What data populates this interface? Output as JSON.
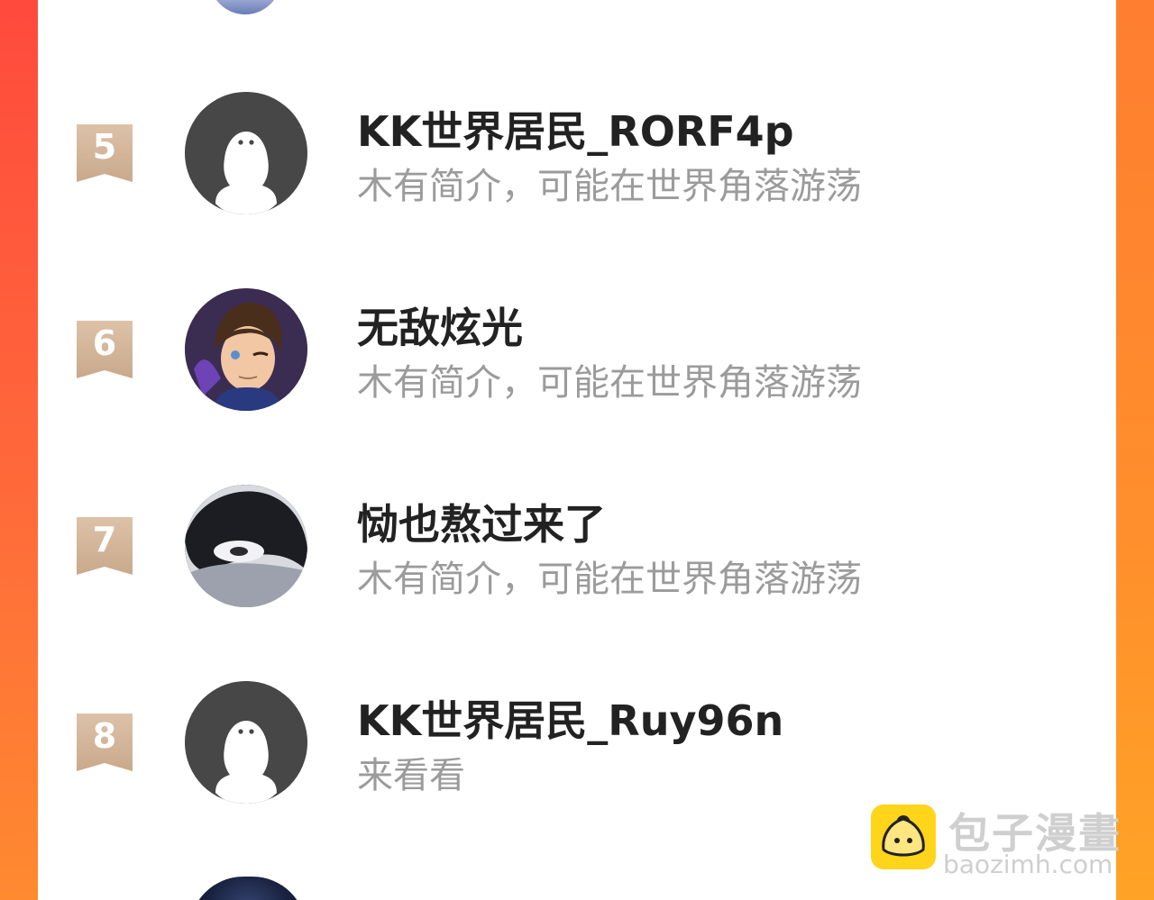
{
  "ranking": {
    "rows": [
      {
        "rank": "5",
        "name": "KK世界居民_RORF4p",
        "bio": "木有简介，可能在世界角落游荡",
        "avatar": "default-ghost-avatar"
      },
      {
        "rank": "6",
        "name": "无敌炫光",
        "bio": "木有简介，可能在世界角落游荡",
        "avatar": "anime-boy-avatar"
      },
      {
        "rank": "7",
        "name": "恸也熬过来了",
        "bio": "木有简介，可能在世界角落游荡",
        "avatar": "dark-portrait-avatar"
      },
      {
        "rank": "8",
        "name": "KK世界居民_Ruy96n",
        "bio": "来看看",
        "avatar": "default-ghost-avatar"
      }
    ]
  },
  "watermark": {
    "title": "包子漫畫",
    "domain": "baozimh.com",
    "logo_icon": "bun-mascot-icon",
    "logo_color": "#ffd51c"
  },
  "colors": {
    "background_left": "#ff4a3d",
    "background_right": "#ff8f2c",
    "rank_badge": "#d4b69a",
    "name_text": "#222222",
    "bio_text": "#9b9b9b"
  }
}
